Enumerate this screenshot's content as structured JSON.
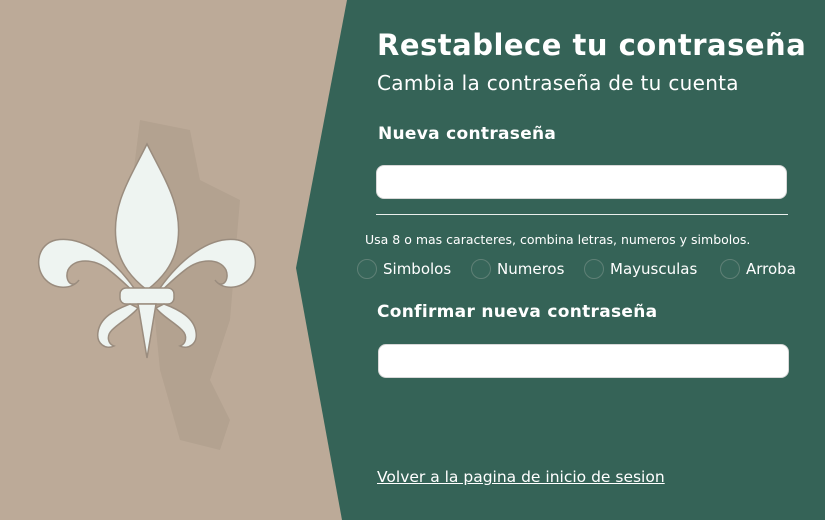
{
  "header": {
    "title": "Restablece tu contraseña",
    "subtitle": "Cambia la contraseña de tu cuenta"
  },
  "form": {
    "new_password_label": "Nueva contraseña",
    "new_password_value": "",
    "hint": "Usa 8 o mas caracteres, combina letras, numeros y simbolos.",
    "requirements": [
      {
        "label": "Simbolos",
        "met": false
      },
      {
        "label": "Numeros",
        "met": false
      },
      {
        "label": "Mayusculas",
        "met": false
      },
      {
        "label": "Arroba",
        "met": false
      }
    ],
    "confirm_password_label": "Confirmar nueva contraseña",
    "confirm_password_value": ""
  },
  "footer": {
    "back_link": "Volver a la pagina de inicio de sesion"
  },
  "colors": {
    "panel_green": "#356357",
    "background_tan": "#bcaa98",
    "logo_white": "#eef4f1"
  },
  "logo": {
    "icon": "fleur-de-lis-icon"
  }
}
